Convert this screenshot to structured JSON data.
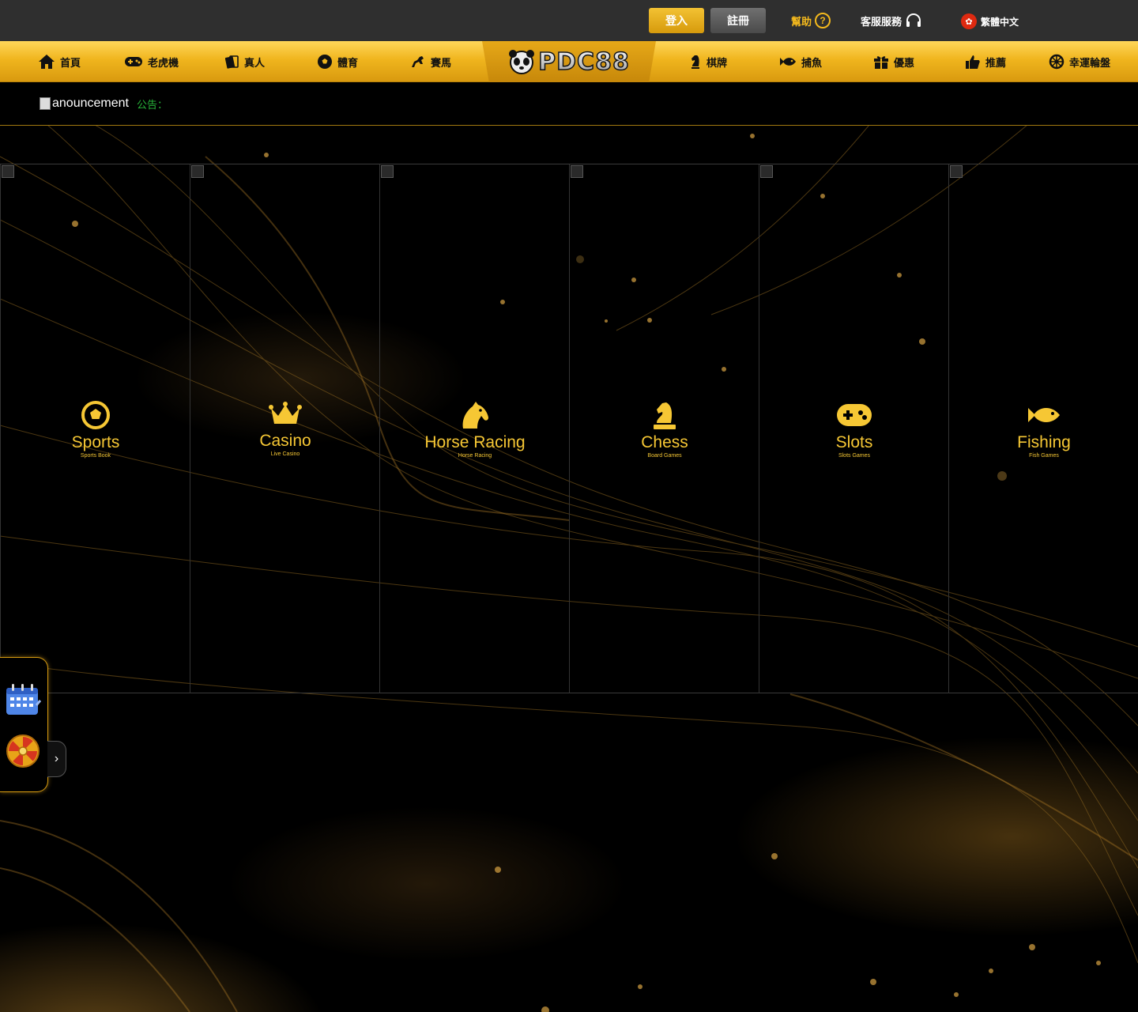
{
  "topbar": {
    "login_label": "登入",
    "register_label": "註冊",
    "help_label": "幫助",
    "help_icon_glyph": "?",
    "support_label": "客服服務",
    "language_label": "繁體中文"
  },
  "nav": {
    "logo_text": "PDC88",
    "items": [
      {
        "label": "首頁",
        "icon": "home-icon"
      },
      {
        "label": "老虎機",
        "icon": "gamepad-icon"
      },
      {
        "label": "真人",
        "icon": "cards-icon"
      },
      {
        "label": "體育",
        "icon": "soccer-ball-icon"
      },
      {
        "label": "賽馬",
        "icon": "horse-icon"
      },
      {
        "label": "棋牌",
        "icon": "chess-knight-icon"
      },
      {
        "label": "捕魚",
        "icon": "fish-icon"
      },
      {
        "label": "優惠",
        "icon": "gift-icon"
      },
      {
        "label": "推薦",
        "icon": "thumbs-up-icon"
      },
      {
        "label": "幸運輪盤",
        "icon": "wheel-icon"
      }
    ]
  },
  "announcement": {
    "image_alt": "anouncement",
    "label": "公告："
  },
  "categories": [
    {
      "title": "Sports",
      "subtitle": "Sports Book",
      "icon": "soccer-ball-icon"
    },
    {
      "title": "Casino",
      "subtitle": "Live Casino",
      "icon": "crown-icon"
    },
    {
      "title": "Horse Racing",
      "subtitle": "Horse Racing",
      "icon": "horse-head-icon"
    },
    {
      "title": "Chess",
      "subtitle": "Board Games",
      "icon": "chess-knight-icon"
    },
    {
      "title": "Slots",
      "subtitle": "Slots Games",
      "icon": "gamepad-icon"
    },
    {
      "title": "Fishing",
      "subtitle": "Fish Games",
      "icon": "fish-icon"
    }
  ],
  "side_panel": {
    "items": [
      {
        "icon": "calendar-icon"
      },
      {
        "icon": "lucky-wheel-icon"
      }
    ],
    "toggle_glyph": "›"
  },
  "colors": {
    "gold": "#f6c734",
    "nav_gold": "#f0b51e",
    "topbar": "#2f2f2f",
    "announce_green": "#28b43a"
  }
}
